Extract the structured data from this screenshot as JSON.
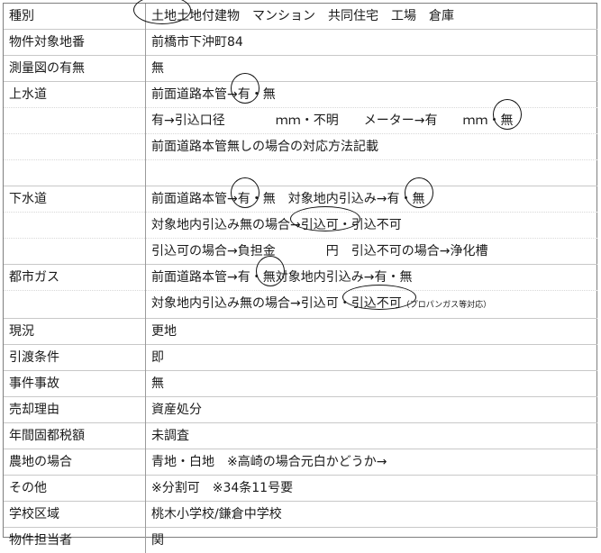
{
  "rows": {
    "r0": {
      "label": "種別",
      "circled": "土地",
      "rest": "土地付建物　マンション　共同住宅　工場　倉庫"
    },
    "r1": {
      "label": "物件対象地番",
      "value": "前橋市下沖町84"
    },
    "r2": {
      "label": "測量図の有無",
      "value": "無"
    },
    "r3": {
      "label": "上水道",
      "a": "前面道路本管→",
      "circled": "有",
      "b": "・無"
    },
    "r4": {
      "a": "有→引込口径　　　　ｍｍ・不明　　メーター→有　　ｍｍ・",
      "circled": "無"
    },
    "r5": {
      "value": "前面道路本管無しの場合の対応方法記載"
    },
    "r6": {
      "value": ""
    },
    "r7": {
      "label": "下水道",
      "a": "前面道路本管→",
      "circled1": "有",
      "b": "・無　対象地内引込み→有・",
      "circled2": "無"
    },
    "r8": {
      "a": "対象地内引込み無の場合→",
      "circled": "引込可",
      "b": "・引込不可"
    },
    "r9": {
      "value": "引込可の場合→負担金　　　　円　引込不可の場合→浄化槽"
    },
    "r10": {
      "label": "都市ガス",
      "a": "前面道路本管→有・",
      "circled": "無",
      "b": "対象地内引込み→有・無"
    },
    "r11": {
      "a": "対象地内引込み無の場合→引込可・",
      "circled": "引込不可",
      "note": "（プロパンガス等対応）"
    },
    "r12": {
      "label": "現況",
      "value": "更地"
    },
    "r13": {
      "label": "引渡条件",
      "value": "即"
    },
    "r14": {
      "label": "事件事故",
      "value": "無"
    },
    "r15": {
      "label": "売却理由",
      "value": "資産処分"
    },
    "r16": {
      "label": "年間固都税額",
      "value": "未調査"
    },
    "r17": {
      "label": "農地の場合",
      "value": "青地・白地　※高崎の場合元白かどうか→"
    },
    "r18": {
      "label": "その他",
      "value": "※分割可　※34条11号要"
    },
    "r19": {
      "label": "学校区域",
      "value": "桃木小学校/鎌倉中学校"
    },
    "r20": {
      "label": "物件担当者",
      "value": "関"
    }
  }
}
